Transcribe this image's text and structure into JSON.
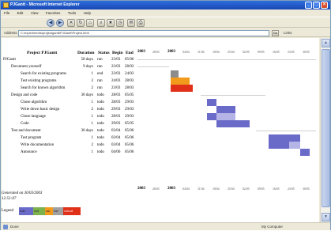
{
  "window": {
    "title": "PJGantt - Microsoft Internet Explorer",
    "controls": {
      "minimize": "_",
      "maximize": "□",
      "close": "×"
    }
  },
  "menu": [
    "File",
    "Edit",
    "View",
    "Favorites",
    "Tools",
    "Help"
  ],
  "toolbar": {
    "buttons": [
      {
        "name": "back-button",
        "glyph": "◀"
      },
      {
        "name": "forward-button",
        "glyph": "▶"
      },
      {
        "name": "stop-button",
        "glyph": "✕"
      },
      {
        "name": "refresh-button",
        "glyph": "↻"
      },
      {
        "name": "home-button",
        "glyph": "⌂"
      },
      {
        "name": "search-button",
        "glyph": "⌕"
      },
      {
        "name": "favorites-button",
        "glyph": "★"
      },
      {
        "name": "history-button",
        "glyph": "◷"
      },
      {
        "name": "mail-button",
        "glyph": "✉"
      },
      {
        "name": "print-button",
        "glyph": "⎙"
      }
    ]
  },
  "address": {
    "label": "Address",
    "value": "C:\\experiments\\projectgantt\\PJGantt\\Project.html",
    "go_label": "Go",
    "links_label": "Links"
  },
  "project": {
    "headers": {
      "name": "Project PJGantt",
      "duration": "Duration",
      "status": "Status",
      "begin": "Begin",
      "end": "End"
    },
    "date_header": [
      {
        "text": "2003",
        "strong": true
      },
      {
        "text": "28/03",
        "strong": false
      },
      {
        "text": "2003",
        "strong": true
      },
      {
        "text": "04/04",
        "strong": false
      },
      {
        "text": "11/04",
        "strong": false
      },
      {
        "text": "18/04",
        "strong": false
      },
      {
        "text": "25/04",
        "strong": false
      },
      {
        "text": "02/05",
        "strong": false
      },
      {
        "text": "09/05",
        "strong": false
      },
      {
        "text": "16/05",
        "strong": false
      },
      {
        "text": "23/05",
        "strong": false
      },
      {
        "text": "30/05",
        "strong": false
      }
    ],
    "rows": [
      {
        "name": "PJGantt",
        "level": 0,
        "duration": "58 days",
        "status": "run",
        "begin": "23/03",
        "end": "05/06",
        "summary": true
      },
      {
        "name": "Document yourself",
        "level": 1,
        "duration": "9 days",
        "status": "run",
        "begin": "23/03",
        "end": "28/03",
        "summary": true
      },
      {
        "name": "Search for existing programs",
        "level": 2,
        "duration": "1",
        "status": "end",
        "begin": "23/03",
        "end": "24/03"
      },
      {
        "name": "Test existing programs",
        "level": 2,
        "duration": "2",
        "status": "run",
        "begin": "24/03",
        "end": "28/03"
      },
      {
        "name": "Search for known algorithm",
        "level": 2,
        "duration": "2",
        "status": "run",
        "begin": "23/03",
        "end": "28/03"
      },
      {
        "name": "Design and code",
        "level": 1,
        "duration": "30 days",
        "status": "todo",
        "begin": "28/03",
        "end": "05/05",
        "summary": true
      },
      {
        "name": "Chose algorithm",
        "level": 2,
        "duration": "1",
        "status": "todo",
        "begin": "28/03",
        "end": "29/03"
      },
      {
        "name": "Write down basic design",
        "level": 2,
        "duration": "2",
        "status": "todo",
        "begin": "29/03",
        "end": "29/03"
      },
      {
        "name": "Chose language",
        "level": 2,
        "duration": "1",
        "status": "todo",
        "begin": "28/03",
        "end": "29/03"
      },
      {
        "name": "Code",
        "level": 2,
        "duration": "1",
        "status": "todo",
        "begin": "29/03",
        "end": "05/05"
      },
      {
        "name": "Test and document",
        "level": 1,
        "duration": "30 days",
        "status": "todo",
        "begin": "03/04",
        "end": "05/06",
        "summary": true
      },
      {
        "name": "Test program",
        "level": 2,
        "duration": "1",
        "status": "todo",
        "begin": "03/04",
        "end": "05/06"
      },
      {
        "name": "Write documentation",
        "level": 2,
        "duration": "2",
        "status": "todo",
        "begin": "03/04",
        "end": "05/06"
      },
      {
        "name": "Announce",
        "level": 2,
        "duration": "1",
        "status": "todo",
        "begin": "04/06",
        "end": "05/06"
      }
    ],
    "observed_label": "Generated on 30/03/2003",
    "observed_time": "12:51:07",
    "legend": {
      "label": "Legend",
      "items": [
        {
          "name": "todo",
          "color": "#6a6ac8",
          "text_color": "#222"
        },
        {
          "name": "end",
          "color": "#7cb24c",
          "text_color": "#222"
        },
        {
          "name": "run",
          "color": "#f29a1c",
          "text_color": "#222"
        },
        {
          "name": "late",
          "color": "#a0a0a0",
          "text_color": "#222"
        },
        {
          "name": "critical",
          "color": "#e03018",
          "text_color": "#fff"
        }
      ]
    }
  },
  "status": {
    "text": "Done",
    "zone": "My Computer"
  },
  "colors": {
    "todo": "#6a6ac8",
    "todo_light": "#b4b4e6",
    "run": "#f29a1c",
    "end": "#8c8c8c",
    "critical": "#e03018",
    "gridline": "#cfcfcf"
  }
}
